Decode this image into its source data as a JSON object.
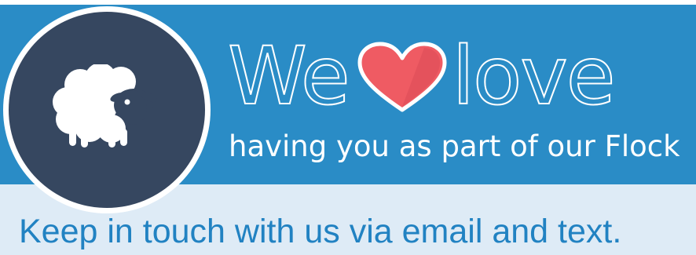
{
  "banner": {
    "headline": {
      "word_before": "We",
      "icon": "heart-icon",
      "word_after": "love"
    },
    "subline": "having you as part of our Flock",
    "tagline": "Keep in touch with us via email and text.",
    "logo": {
      "icon": "sheep-icon"
    },
    "colors": {
      "top_band": "#2a8cc6",
      "bottom_band": "#deebf6",
      "logo_circle": "#364760",
      "heart": "#ef5b63",
      "tagline_text": "#2182c2"
    }
  }
}
